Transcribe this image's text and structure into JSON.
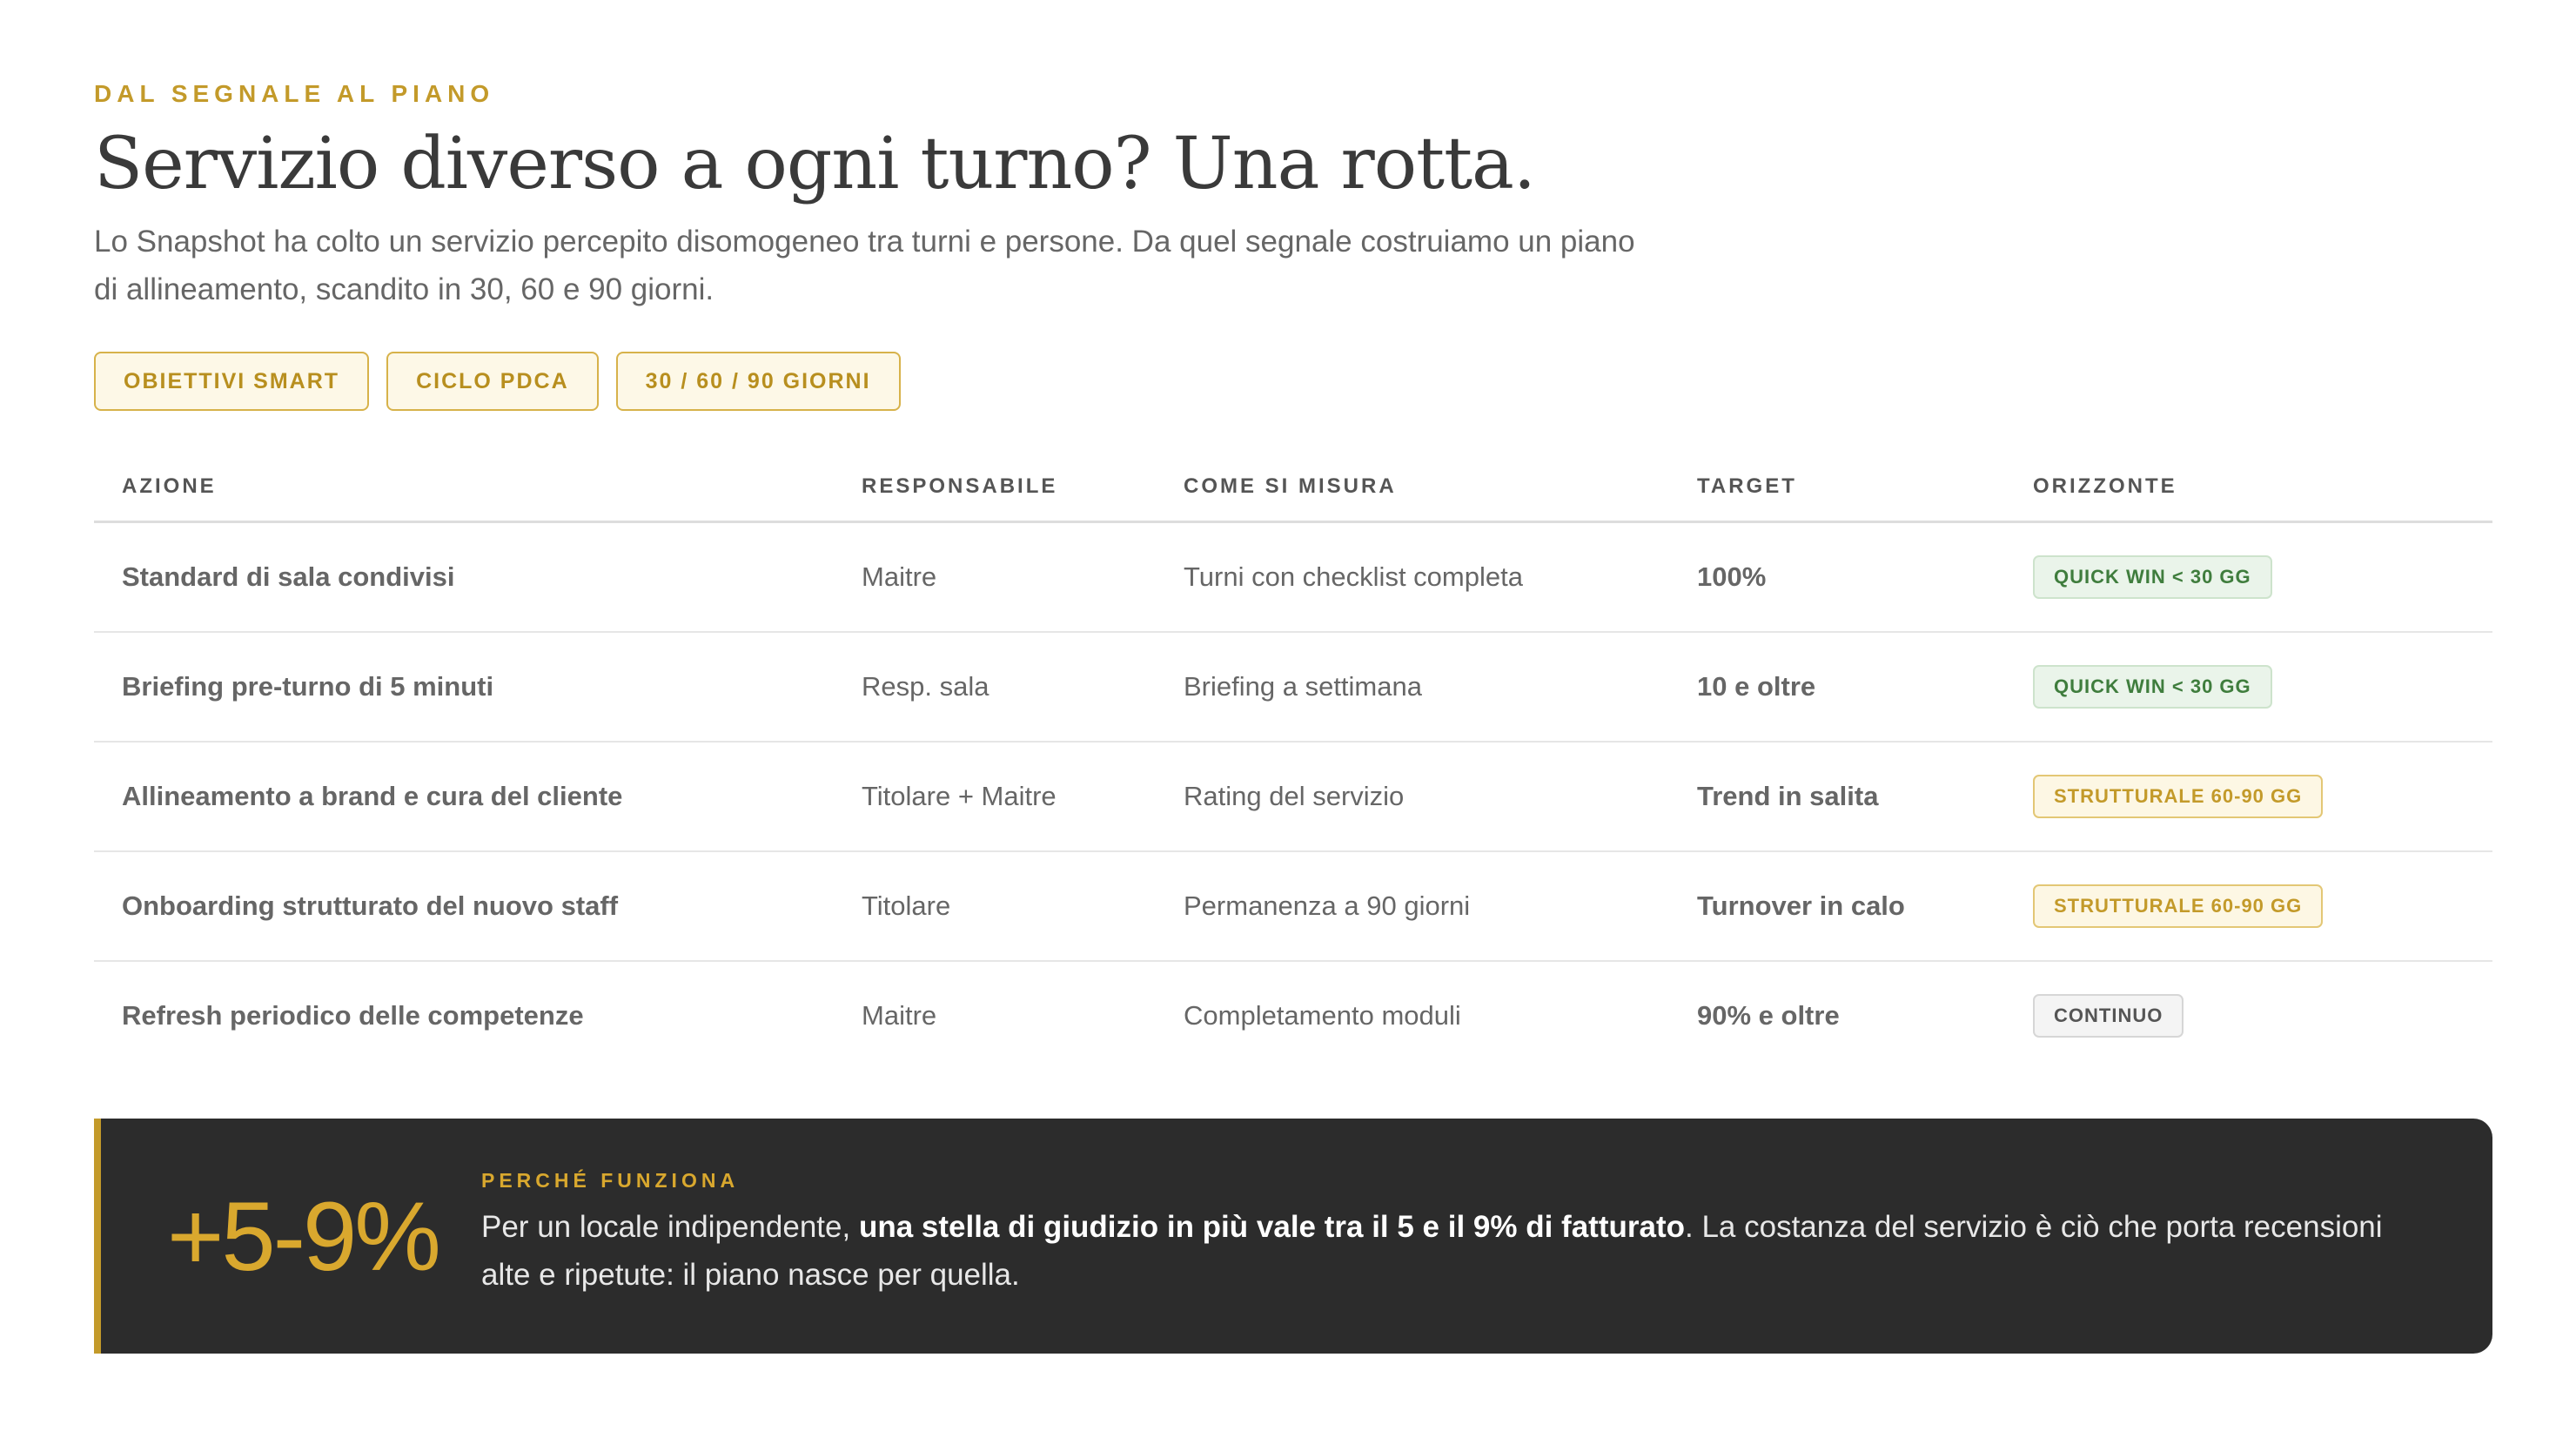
{
  "header": {
    "eyebrow": "DAL SEGNALE AL PIANO",
    "title": "Servizio diverso a ogni turno? Una rotta.",
    "intro": "Lo Snapshot ha colto un servizio percepito disomogeneo tra turni e persone. Da quel segnale costruiamo un piano di allineamento, scandito in 30, 60 e 90 giorni."
  },
  "tags": [
    "OBIETTIVI SMART",
    "CICLO PDCA",
    "30 / 60 / 90 GIORNI"
  ],
  "table": {
    "columns": [
      "AZIONE",
      "RESPONSABILE",
      "COME SI MISURA",
      "TARGET",
      "ORIZZONTE"
    ],
    "rows": [
      {
        "action": "Standard di sala condivisi",
        "owner": "Maitre",
        "measure": "Turni con checklist completa",
        "target": "100%",
        "horizon": "QUICK WIN < 30 GG"
      },
      {
        "action": "Briefing pre-turno di 5 minuti",
        "owner": "Resp. sala",
        "measure": "Briefing a settimana",
        "target": "10 e oltre",
        "horizon": "QUICK WIN < 30 GG"
      },
      {
        "action": "Allineamento a brand e cura del cliente",
        "owner": "Titolare + Maitre",
        "measure": "Rating del servizio",
        "target": "Trend in salita",
        "horizon": "STRUTTURALE 60-90 GG"
      },
      {
        "action": "Onboarding strutturato del nuovo staff",
        "owner": "Titolare",
        "measure": "Permanenza a 90 giorni",
        "target": "Turnover in calo",
        "horizon": "STRUTTURALE 60-90 GG"
      },
      {
        "action": "Refresh periodico delle competenze",
        "owner": "Maitre",
        "measure": "Completamento moduli",
        "target": "90% e oltre",
        "horizon": "CONTINUO"
      }
    ]
  },
  "callout": {
    "stat": "+5-9%",
    "eyebrow": "PERCHÉ FUNZIONA",
    "body_start": "Per un locale indipendente, ",
    "body_bold": "una stella di giudizio in più vale tra il 5 e il 9% di fatturato",
    "body_end": ". La costanza del servizio è ciò che porta recensioni alte e ripetute: il piano nasce per quella."
  },
  "colors": {
    "accent": "#c39a2a",
    "quick_win": "#3f7d3d",
    "callout_bg": "#2c2c2c"
  }
}
